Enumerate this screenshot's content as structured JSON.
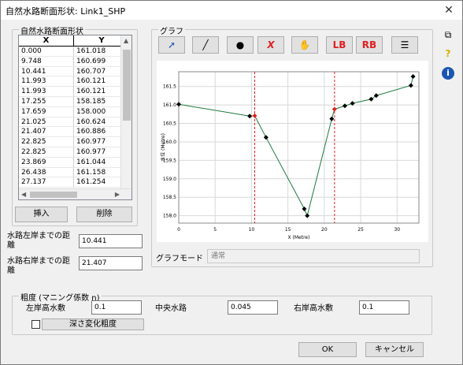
{
  "window": {
    "title": "自然水路断面形状: Link1_SHP"
  },
  "section_panel": {
    "legend": "自然水路断面形状",
    "col_x": "X",
    "col_y": "Y",
    "rows": [
      [
        "0.000",
        "161.018"
      ],
      [
        "9.748",
        "160.699"
      ],
      [
        "10.441",
        "160.707"
      ],
      [
        "11.993",
        "160.121"
      ],
      [
        "11.993",
        "160.121"
      ],
      [
        "17.255",
        "158.185"
      ],
      [
        "17.659",
        "158.000"
      ],
      [
        "21.025",
        "160.624"
      ],
      [
        "21.407",
        "160.886"
      ],
      [
        "22.825",
        "160.977"
      ],
      [
        "22.825",
        "160.977"
      ],
      [
        "23.869",
        "161.044"
      ],
      [
        "26.438",
        "161.158"
      ],
      [
        "27.137",
        "161.254"
      ]
    ],
    "insert_label": "挿入",
    "delete_label": "削除"
  },
  "left_bank": {
    "label": "水路左岸までの距離",
    "value": "10.441"
  },
  "right_bank": {
    "label": "水路右岸までの距離",
    "value": "21.407"
  },
  "graph_panel": {
    "legend": "グラフ",
    "tools": {
      "lb": "LB",
      "rb": "RB"
    },
    "mode_label": "グラフモード",
    "mode_value": "通常"
  },
  "chart_data": {
    "type": "line",
    "x": [
      0.0,
      9.748,
      10.441,
      11.993,
      17.255,
      17.659,
      21.025,
      21.407,
      22.825,
      23.869,
      26.438,
      27.137,
      31.9,
      32.2
    ],
    "y": [
      161.018,
      160.699,
      160.707,
      160.121,
      158.185,
      158.0,
      160.624,
      160.886,
      160.977,
      161.044,
      161.158,
      161.254,
      161.53,
      161.772
    ],
    "xlabel": "X (Metre)",
    "ylabel": "水位 (Metre)",
    "xlim": [
      0,
      33
    ],
    "ylim": [
      157.8,
      161.9
    ],
    "xticks": [
      0,
      5,
      10,
      15,
      20,
      25,
      30
    ],
    "yticks": [
      158.0,
      158.5,
      159.0,
      159.5,
      160.0,
      160.5,
      161.0,
      161.5
    ],
    "vlines": [
      10.441,
      21.407
    ],
    "highlight_points": [
      10.441,
      21.407
    ],
    "grid": true,
    "line_color": "#1a7a3a",
    "marker_color": "#000000",
    "highlight_color": "#e02020",
    "vline_color": "#e02020"
  },
  "roughness": {
    "legend": "粗度 (マニング係数 n)",
    "left_label": "左岸高水敷",
    "left_value": "0.1",
    "center_label": "中央水路",
    "center_value": "0.045",
    "right_label": "右岸高水敷",
    "right_value": "0.1",
    "depth_label": "深さ変化粗度"
  },
  "footer": {
    "ok": "OK",
    "cancel": "キャンセル"
  },
  "sidebar": {
    "help": "?",
    "info": "i"
  }
}
